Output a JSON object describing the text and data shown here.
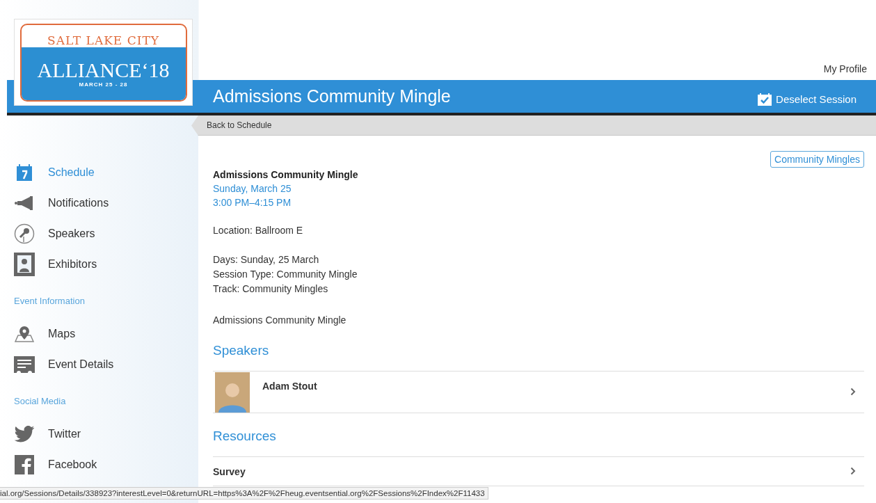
{
  "logo": {
    "city": "SALT LAKE CITY",
    "name": "ALLIANCE",
    "year": "‘18",
    "dates": "MARCH 25 - 28"
  },
  "top_link": "My Profile",
  "header": {
    "title": "Admissions Community Mingle",
    "action": "Deselect Session",
    "action_checked": true
  },
  "back_link": "Back to Schedule",
  "sidebar": {
    "sections": [
      {
        "items": [
          {
            "label": "Schedule",
            "selected": true
          },
          {
            "label": "Notifications",
            "selected": false
          },
          {
            "label": "Speakers",
            "selected": false
          },
          {
            "label": "Exhibitors",
            "selected": false
          }
        ]
      },
      {
        "heading": "Event Information",
        "items": [
          {
            "label": "Maps",
            "selected": false
          },
          {
            "label": "Event Details",
            "selected": false
          }
        ]
      },
      {
        "heading": "Social Media",
        "items": [
          {
            "label": "Twitter",
            "selected": false
          },
          {
            "label": "Facebook",
            "selected": false
          }
        ]
      }
    ]
  },
  "session": {
    "tag": "Community Mingles",
    "title": "Admissions Community Mingle",
    "date": "Sunday, March 25",
    "time": "3:00 PM–4:15 PM",
    "location": "Location: Ballroom E",
    "meta": [
      "Days: Sunday, 25 March",
      "Session Type: Community Mingle",
      "Track: Community Mingles"
    ],
    "description": "Admissions Community Mingle"
  },
  "speakers": {
    "heading": "Speakers",
    "items": [
      {
        "name": "Adam Stout"
      }
    ]
  },
  "resources": {
    "heading": "Resources",
    "items": [
      {
        "name": "Survey"
      }
    ]
  },
  "status_bar": "ial.org/Sessions/Details/338923?interestLevel=0&returnURL=https%3A%2F%2Fheug.eventsential.org%2FSessions%2FIndex%2F11433"
}
